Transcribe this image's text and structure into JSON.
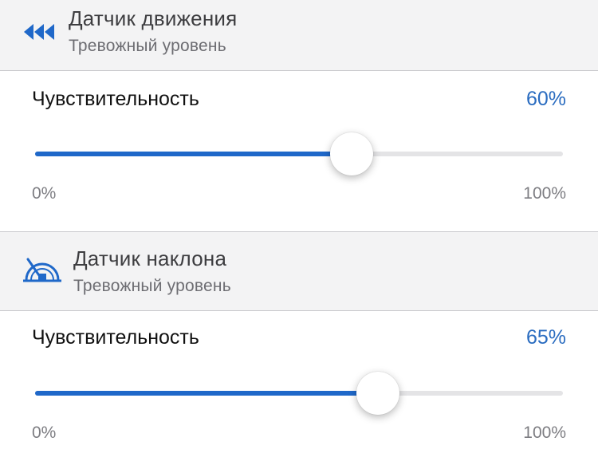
{
  "motion_sensor": {
    "title": "Датчик движения",
    "subtitle": "Тревожный уровень",
    "icon": "motion-arrows-icon",
    "sensitivity_label": "Чувствительность",
    "value_text": "60%",
    "value": 0.6,
    "min_label": "0%",
    "max_label": "100%"
  },
  "tilt_sensor": {
    "title": "Датчик наклона",
    "subtitle": "Тревожный уровень",
    "icon": "tilt-gauge-icon",
    "sensitivity_label": "Чувствительность",
    "value_text": "65%",
    "value": 0.65,
    "min_label": "0%",
    "max_label": "100%"
  },
  "colors": {
    "accent": "#1f68c9",
    "value_text": "#2a6cc0",
    "track": "#e4e4e6",
    "header_bg": "#f3f3f4"
  }
}
